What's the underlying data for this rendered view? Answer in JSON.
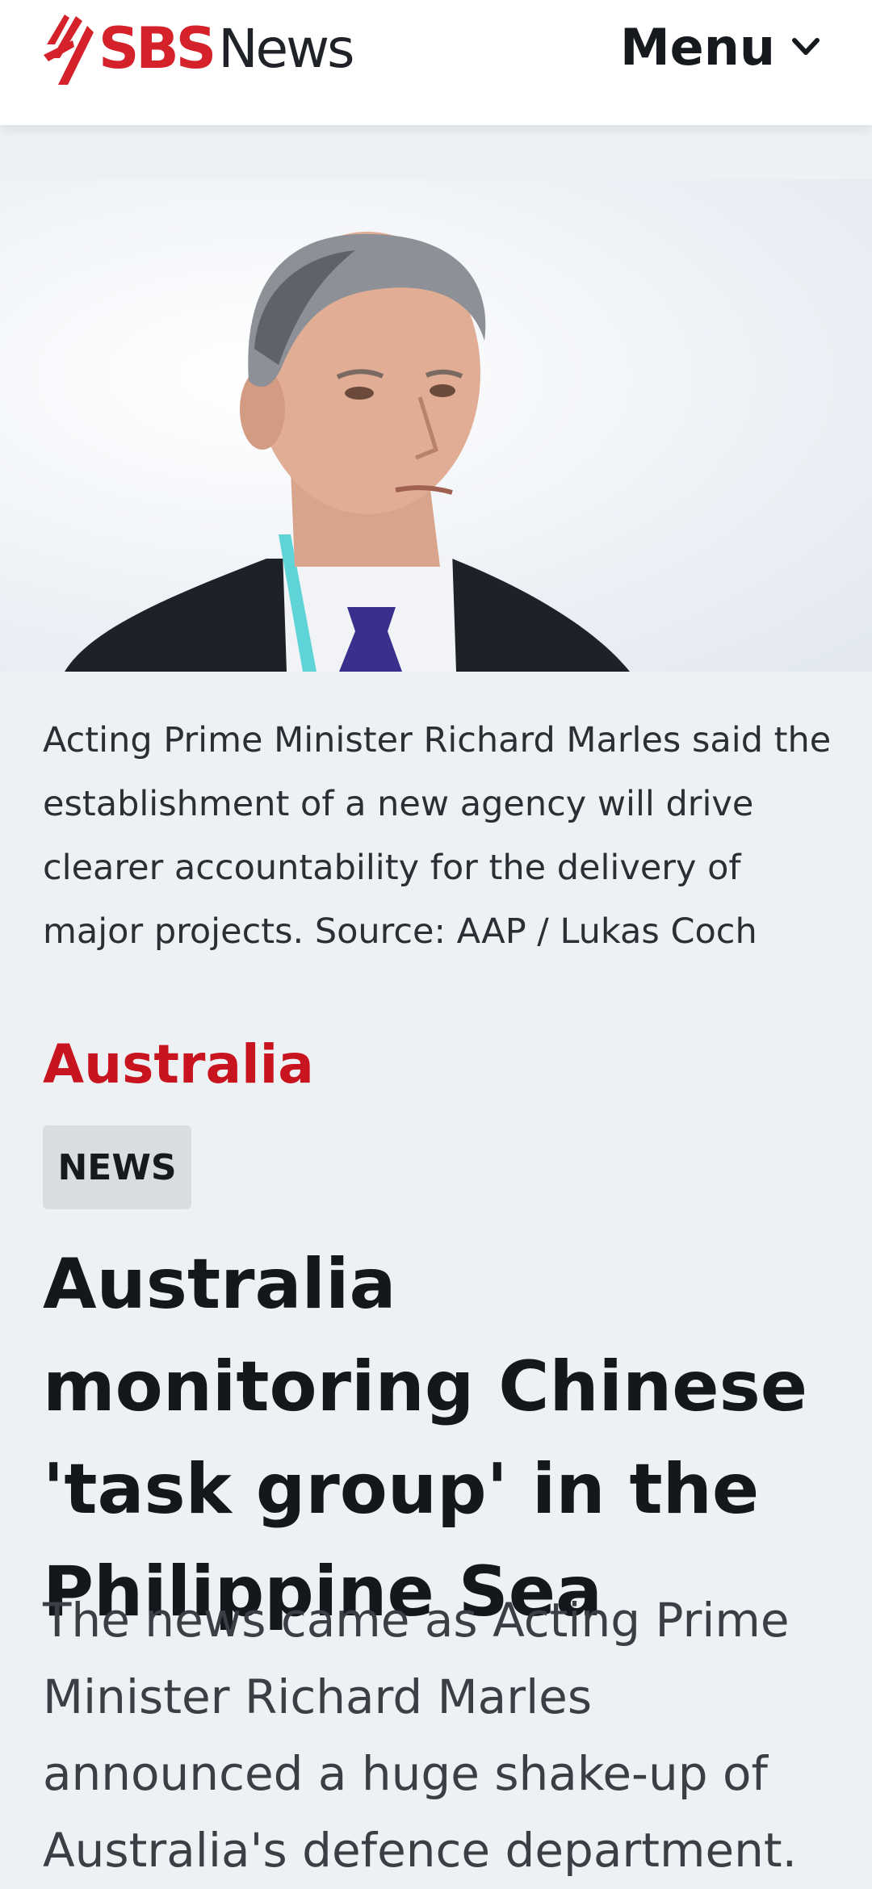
{
  "header": {
    "logo_sbs": "SBS",
    "logo_news": "News",
    "menu_label": "Menu",
    "menu_icon": "chevron-down-icon"
  },
  "hero": {
    "image_alt": "Acting Prime Minister Richard Marles",
    "caption": "Acting Prime Minister Richard Marles said the establishment of a new agency will drive clearer accountability for the delivery of major projects. Source: AAP / Lukas Coch"
  },
  "article": {
    "category": "Australia",
    "badge": "NEWS",
    "headline": "Australia monitoring Chinese 'task group' in the Philippine Sea",
    "standfirst": "The news came as Acting Prime Minister Richard Marles announced a huge shake-up of Australia's defence department."
  },
  "colors": {
    "brand_red": "#d4212a",
    "category_red": "#c8141e",
    "page_bg": "#eef1f4",
    "badge_bg": "#d9dce1"
  }
}
